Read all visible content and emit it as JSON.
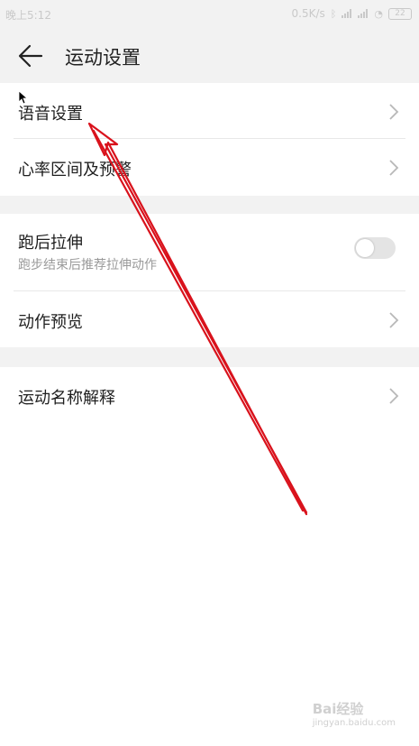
{
  "status_bar": {
    "time": "晚上5:12",
    "network_speed": "0.5K/s",
    "battery": "22",
    "icons": [
      "bluetooth-icon",
      "signal-icon",
      "signal-icon",
      "wifi-icon",
      "battery-icon"
    ]
  },
  "header": {
    "title": "运动设置",
    "back_icon": "arrow-left-icon"
  },
  "section1": {
    "items": [
      {
        "label": "语音设置",
        "icon": "chevron-right-icon"
      },
      {
        "label": "心率区间及预警",
        "icon": "chevron-right-icon"
      }
    ]
  },
  "section2": {
    "stretch": {
      "label": "跑后拉伸",
      "subtitle": "跑步结束后推荐拉伸动作",
      "toggle_on": false
    },
    "preview": {
      "label": "动作预览",
      "icon": "chevron-right-icon"
    }
  },
  "section3": {
    "items": [
      {
        "label": "运动名称解释",
        "icon": "chevron-right-icon"
      }
    ]
  },
  "annotation": {
    "color": "#d9121c",
    "cursor_icon": "mouse-pointer-icon"
  },
  "watermark": {
    "text": "Bai经验",
    "domain": "jingyan.baidu.com"
  },
  "colors": {
    "background": "#ffffff",
    "section_gap": "#f2f2f2",
    "toggle_off": "#e4e4e4",
    "annotation_arrow": "#d9121c"
  }
}
